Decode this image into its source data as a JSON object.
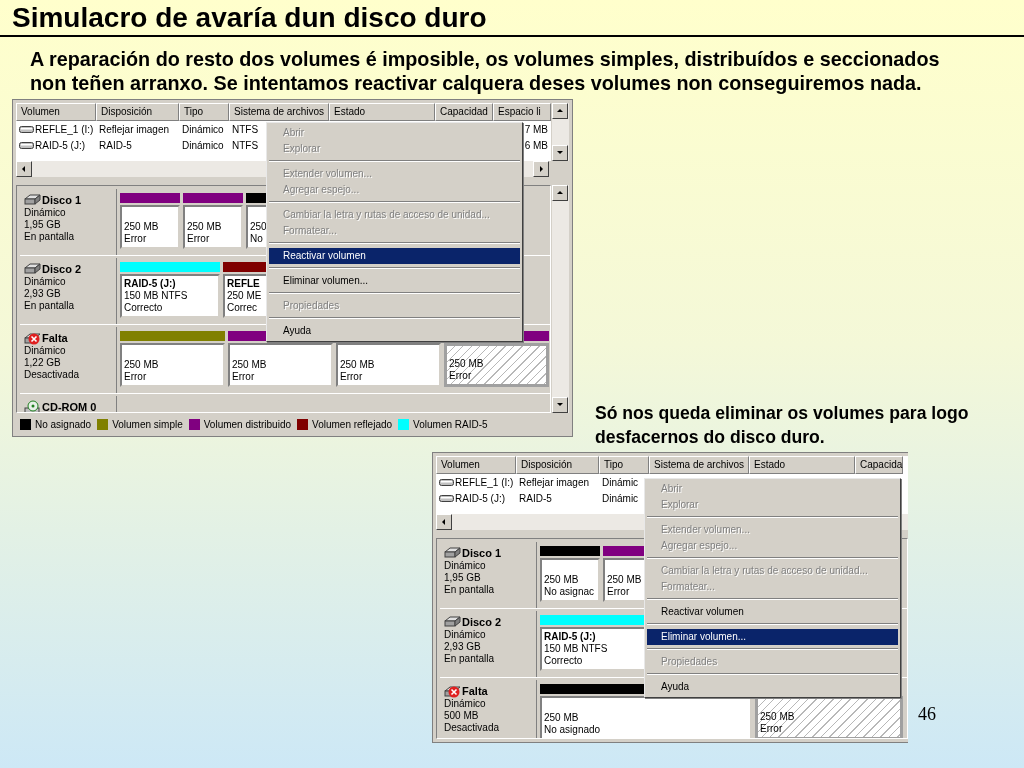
{
  "title": "Simulacro de avaría dun disco duro",
  "intro": "A reparación do resto dos volumes é imposible, os volumes simples, distribuídos e seccionados non teñen arranxo. Se intentamos reactivar calquera deses volumes non conseguiremos nada.",
  "screenshots": [
    {
      "columns": [
        "Volumen",
        "Disposición",
        "Tipo",
        "Sistema de archivos",
        "Estado",
        "Capacidad",
        "Espacio li"
      ],
      "rows": [
        {
          "cells": [
            "REFLE_1 (I:)",
            "Reflejar imagen",
            "Dinámico",
            "NTFS"
          ],
          "tail": "7 MB"
        },
        {
          "cells": [
            "RAID-5 (J:)",
            "RAID-5",
            "Dinámico",
            "NTFS"
          ],
          "tail": "6 MB"
        }
      ],
      "disks": [
        {
          "name": "Disco 1",
          "kind": "online",
          "lines": [
            "Dinámico",
            "1,95 GB",
            "En pantalla"
          ],
          "segments": [
            {
              "color": "#800080",
              "lines": [
                "250 MB",
                "Error"
              ],
              "hatched": false
            },
            {
              "color": "#800080",
              "lines": [
                "250 MB",
                "Error"
              ],
              "hatched": false
            },
            {
              "color": "#000000",
              "lines": [
                "250",
                "No"
              ],
              "hatched": false
            }
          ]
        },
        {
          "name": "Disco 2",
          "kind": "online",
          "lines": [
            "Dinámico",
            "2,93 GB",
            "En pantalla"
          ],
          "segments": [
            {
              "color": "#00ffff",
              "title": "RAID-5  (J:)",
              "lines": [
                "150 MB NTFS",
                "Correcto"
              ],
              "hatched": false
            },
            {
              "color": "#800000",
              "title": "REFLE",
              "lines": [
                "250 ME",
                "Correc"
              ],
              "hatched": false
            }
          ]
        },
        {
          "name": "Falta",
          "kind": "missing",
          "lines": [
            "Dinámico",
            "1,22 GB",
            "Desactivada"
          ],
          "segments": [
            {
              "color": "#808000",
              "lines": [
                "250 MB",
                "Error"
              ],
              "hatched": false
            },
            {
              "color": "#800080",
              "lines": [
                "250 MB",
                "Error"
              ],
              "hatched": false
            },
            {
              "lines": [
                "250 MB",
                "Error"
              ],
              "hatched": false
            },
            {
              "color": "#800080",
              "lines": [
                "250 MB",
                "Error"
              ],
              "hatched": true
            }
          ]
        },
        {
          "name": "CD-ROM 0",
          "kind": "cdrom"
        }
      ],
      "legend": [
        {
          "label": "No asignado",
          "color": "#000000"
        },
        {
          "label": "Volumen simple",
          "color": "#808000"
        },
        {
          "label": "Volumen distribuido",
          "color": "#800080"
        },
        {
          "label": "Volumen reflejado",
          "color": "#800000"
        },
        {
          "label": "Volumen RAID-5",
          "color": "#00ffff"
        }
      ],
      "menu": {
        "groups": [
          [
            {
              "label": "Abrir",
              "disabled": true,
              "selected": false
            },
            {
              "label": "Explorar",
              "disabled": true,
              "selected": false
            }
          ],
          [
            {
              "label": "Extender volumen...",
              "disabled": true,
              "selected": false
            },
            {
              "label": "Agregar espejo...",
              "disabled": true,
              "selected": false
            }
          ],
          [
            {
              "label": "Cambiar la letra y rutas de acceso de unidad...",
              "disabled": true,
              "selected": false
            },
            {
              "label": "Formatear...",
              "disabled": true,
              "selected": false
            }
          ],
          [
            {
              "label": "Reactivar volumen",
              "disabled": false,
              "selected": true
            }
          ],
          [
            {
              "label": "Eliminar volumen...",
              "disabled": false,
              "selected": false
            }
          ],
          [
            {
              "label": "Propiedades",
              "disabled": true,
              "selected": false
            }
          ],
          [
            {
              "label": "Ayuda",
              "disabled": false,
              "selected": false
            }
          ]
        ]
      }
    },
    {
      "columns": [
        "Volumen",
        "Disposición",
        "Tipo",
        "Sistema de archivos",
        "Estado",
        "Capacida"
      ],
      "rows": [
        {
          "cells": [
            "REFLE_1 (I:)",
            "Reflejar imagen",
            "Dinámic"
          ]
        },
        {
          "cells": [
            "RAID-5 (J:)",
            "RAID-5",
            "Dinámic"
          ]
        }
      ],
      "disks": [
        {
          "name": "Disco 1",
          "kind": "online",
          "lines": [
            "Dinámico",
            "1,95 GB",
            "En pantalla"
          ],
          "segments": [
            {
              "color": "#000000",
              "lines": [
                "250 MB",
                "No asignac"
              ],
              "hatched": false
            },
            {
              "color": "#800080",
              "lines": [
                "250 MB",
                "Error"
              ],
              "hatched": false
            }
          ]
        },
        {
          "name": "Disco 2",
          "kind": "online",
          "lines": [
            "Dinámico",
            "2,93 GB",
            "En pantalla"
          ],
          "segments": [
            {
              "color": "#00ffff",
              "title": "RAID-5  (J:)",
              "lines": [
                "150 MB NTFS",
                "Correcto"
              ],
              "hatched": false
            }
          ]
        },
        {
          "name": "Falta",
          "kind": "missing",
          "lines": [
            "Dinámico",
            "500 MB",
            "Desactivada"
          ],
          "segments": [
            {
              "color": "#000000",
              "lines": [
                "250 MB",
                "No asignado"
              ],
              "hatched": false
            },
            {
              "lines": [
                "250 MB",
                "Error"
              ],
              "hatched": true
            }
          ]
        }
      ],
      "menu": {
        "groups": [
          [
            {
              "label": "Abrir",
              "disabled": true,
              "selected": false
            },
            {
              "label": "Explorar",
              "disabled": true,
              "selected": false
            }
          ],
          [
            {
              "label": "Extender volumen...",
              "disabled": true,
              "selected": false
            },
            {
              "label": "Agregar espejo...",
              "disabled": true,
              "selected": false
            }
          ],
          [
            {
              "label": "Cambiar la letra y rutas de acceso de unidad...",
              "disabled": true,
              "selected": false
            },
            {
              "label": "Formatear...",
              "disabled": true,
              "selected": false
            }
          ],
          [
            {
              "label": "Reactivar volumen",
              "disabled": false,
              "selected": false
            }
          ],
          [
            {
              "label": "Eliminar volumen...",
              "disabled": false,
              "selected": true
            }
          ],
          [
            {
              "label": "Propiedades",
              "disabled": true,
              "selected": false
            }
          ],
          [
            {
              "label": "Ayuda",
              "disabled": false,
              "selected": false
            }
          ]
        ]
      }
    }
  ],
  "note": "Só nos queda eliminar os volumes para logo desfacernos do disco duro.",
  "page_number": "46"
}
